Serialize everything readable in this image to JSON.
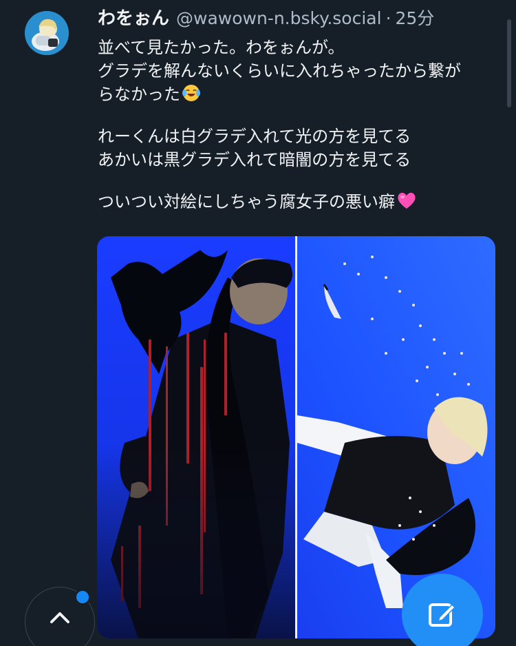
{
  "post": {
    "author": {
      "display_name": "わをぉん",
      "handle": "@wawown-n.bsky.social",
      "separator": "·",
      "time": "25分"
    },
    "text_lines": [
      "並べて見たかった。わをぉんが。",
      "グラデを解んないくらいに入れちゃったから繋が",
      "らなかった",
      "",
      "れーくんは白グラデ入れて光の方を見てる",
      "あかいは黒グラデ入れて暗闇の方を見てる",
      "",
      "ついつい対絵にしちゃう腐女子の悪い癖"
    ],
    "emoji": {
      "line3": "laughing-tears-emoji",
      "line8": "pink-heart-emoji"
    },
    "media": {
      "panels": [
        "left-panel-dark-figure-with-crow",
        "right-panel-blonde-figure-falling"
      ]
    }
  },
  "controls": {
    "scroll_top_icon": "chevron-up-icon",
    "compose_icon": "compose-icon"
  },
  "colors": {
    "background": "#161e27",
    "text": "#f1f3f5",
    "muted": "#aebbc9",
    "accent": "#218ff6",
    "illustration_blue": "#1a46ff"
  }
}
